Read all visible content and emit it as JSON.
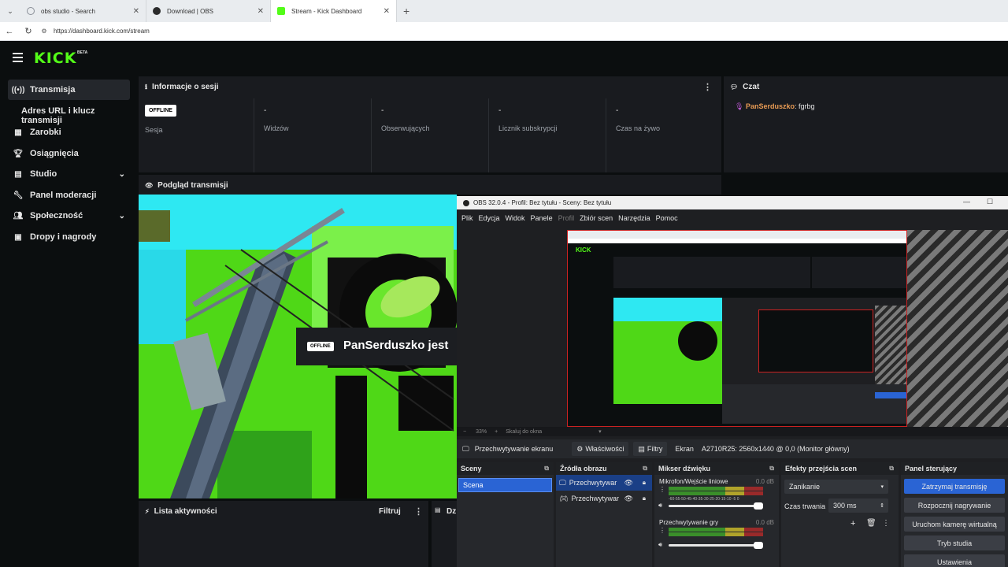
{
  "browser": {
    "tabs": [
      {
        "title": "obs studio - Search",
        "favicon_color": "#8a8f98"
      },
      {
        "title": "Download | OBS",
        "favicon_color": "#2b2b2b"
      },
      {
        "title": "Stream - Kick Dashboard",
        "favicon_color": "#53fc18"
      }
    ],
    "url": "https://dashboard.kick.com/stream"
  },
  "kick": {
    "logo": "KICK",
    "beta": "BETA",
    "accent": "#53fc18",
    "sidebar": [
      {
        "label": "Transmisja",
        "icon": "broadcast-icon",
        "active": true
      },
      {
        "label": "Adres URL i klucz transmisji",
        "sub": true
      },
      {
        "label": "Zarobki",
        "icon": "dollar-icon"
      },
      {
        "label": "Osiągnięcia",
        "icon": "trophy-icon"
      },
      {
        "label": "Studio",
        "icon": "grid-icon",
        "chevron": true
      },
      {
        "label": "Panel moderacji",
        "icon": "wrench-icon"
      },
      {
        "label": "Społeczność",
        "icon": "users-icon",
        "chevron": true
      },
      {
        "label": "Dropy i nagrody",
        "icon": "gift-icon"
      }
    ],
    "session_panel": {
      "title": "Informacje o sesji",
      "status_badge": "OFFLINE",
      "session_label": "Sesja",
      "stats": [
        {
          "value": "-",
          "label": "Widzów"
        },
        {
          "value": "-",
          "label": "Obserwujących"
        },
        {
          "value": "-",
          "label": "Licznik subskrypcji"
        },
        {
          "value": "-",
          "label": "Czas na żywo"
        }
      ]
    },
    "chat": {
      "title": "Czat",
      "messages": [
        {
          "user": "PanSerduszko",
          "sep": ":",
          "text": "fgrbg",
          "user_color": "#e89b54"
        }
      ]
    },
    "preview": {
      "title": "Podgląd transmisji",
      "offline_badge": "OFFLINE",
      "offline_text": "PanSerduszko jest"
    },
    "activity": {
      "title": "Lista aktywności",
      "filter": "Filtruj",
      "next_title": "Dz"
    }
  },
  "obs": {
    "title": "OBS 32.0.4 - Profil: Bez tytułu - Sceny: Bez tytułu",
    "menu": [
      "Plik",
      "Edycja",
      "Widok",
      "Panele",
      "Profil",
      "Zbiór scen",
      "Narzędzia",
      "Pomoc"
    ],
    "zoom": "33%",
    "scale_option": "Skaluj do okna",
    "source_bar": {
      "current_source": "Przechwytywanie ekranu",
      "properties": "Właściwości",
      "filters": "Filtry",
      "screen_label": "Ekran",
      "screen_value": "A2710R25: 2560x1440 @ 0,0 (Monitor główny)"
    },
    "scenes": {
      "title": "Sceny",
      "items": [
        "Scena"
      ]
    },
    "sources": {
      "title": "Źródła obrazu",
      "items": [
        "Przechwytywar",
        "Przechwytywar"
      ]
    },
    "mixer": {
      "title": "Mikser dźwięku",
      "channels": [
        {
          "name": "Mikrofon/Wejście liniowe",
          "db": "0.0 dB",
          "level": 0.72
        },
        {
          "name": "Przechwytywanie gry",
          "db": "0.0 dB",
          "level": 0.78
        }
      ],
      "scale": "-60-55-50-45-40-35-30-25-20-15-10 -5 0"
    },
    "transitions": {
      "title": "Efekty przejścia scen",
      "transition": "Zanikanie",
      "duration_label": "Czas trwania",
      "duration_value": "300 ms"
    },
    "controls": {
      "title": "Panel sterujący",
      "buttons": [
        "Zatrzymaj transmisję",
        "Rozpocznij nagrywanie",
        "Uruchom kamerę wirtualną",
        "Tryb studia",
        "Ustawienia"
      ]
    }
  }
}
